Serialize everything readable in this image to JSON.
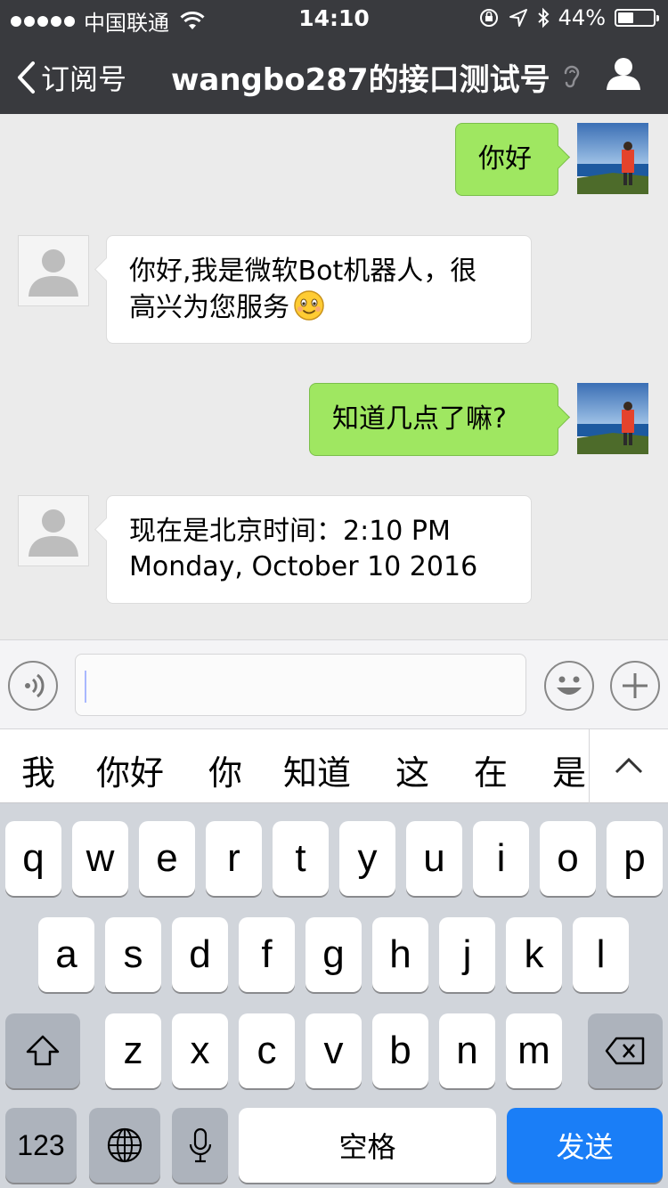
{
  "status_bar": {
    "carrier": "中国联通",
    "time": "14:10",
    "battery": "44%",
    "battery_level": 0.44
  },
  "nav": {
    "back_label": "订阅号",
    "title": "wangbo287的接口测试号"
  },
  "messages": [
    {
      "sender": "me",
      "text": "你好"
    },
    {
      "sender": "bot",
      "lines": [
        "你好,我是微软Bot机器人，很",
        "高兴为您服务"
      ],
      "emoji": "smile-emoji"
    },
    {
      "sender": "me",
      "text": "知道几点了嘛?"
    },
    {
      "sender": "bot",
      "lines": [
        "现在是北京时间：2:10 PM",
        "Monday, October 10 2016"
      ]
    }
  ],
  "input": {
    "value": ""
  },
  "candidates": [
    "我",
    "你好",
    "你",
    "知道",
    "这",
    "在",
    "是"
  ],
  "keyboard": {
    "row1": [
      "q",
      "w",
      "e",
      "r",
      "t",
      "y",
      "u",
      "i",
      "o",
      "p"
    ],
    "row2": [
      "a",
      "s",
      "d",
      "f",
      "g",
      "h",
      "j",
      "k",
      "l"
    ],
    "row3": [
      "z",
      "x",
      "c",
      "v",
      "b",
      "n",
      "m"
    ],
    "num_label": "123",
    "space_label": "空格",
    "send_label": "发送"
  },
  "colors": {
    "nav_bg": "#393a3e",
    "chat_bg": "#ebebeb",
    "my_bubble": "#9fe761",
    "send_key": "#1a7ef7"
  }
}
